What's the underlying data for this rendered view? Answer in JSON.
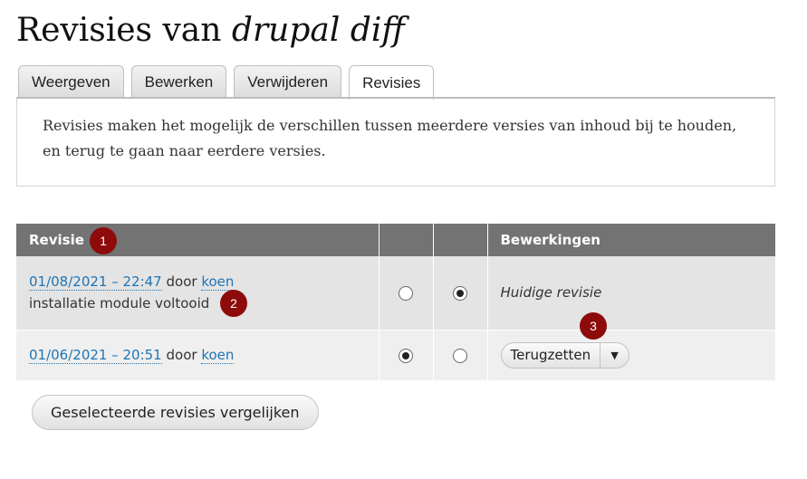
{
  "page": {
    "title_prefix": "Revisies van",
    "title_node": "drupal diff"
  },
  "tabs": [
    {
      "label": "Weergeven",
      "active": false
    },
    {
      "label": "Bewerken",
      "active": false
    },
    {
      "label": "Verwijderen",
      "active": false
    },
    {
      "label": "Revisies",
      "active": true
    }
  ],
  "help": {
    "text": "Revisies maken het mogelijk de verschillen tussen meerdere versies van inhoud bij te houden, en terug te gaan naar eerdere versies."
  },
  "table": {
    "headers": {
      "revision": "Revisie",
      "radio1": "",
      "radio2": "",
      "operations": "Bewerkingen"
    },
    "rows": [
      {
        "date": "01/08/2021 – 22:47",
        "by": "door",
        "author": "koen",
        "message": "installatie module voltooid",
        "radio_left_checked": false,
        "radio_right_checked": true,
        "operation": "Huidige revisie"
      },
      {
        "date": "01/06/2021 – 20:51",
        "by": "door",
        "author": "koen",
        "message": "",
        "radio_left_checked": true,
        "radio_right_checked": false,
        "operation": "Terugzetten"
      }
    ]
  },
  "compare_button": {
    "label": "Geselecteerde revisies vergelijken"
  },
  "markers": [
    "1",
    "2",
    "3"
  ],
  "colors": {
    "header_bg": "#737373",
    "link": "#1f74b5",
    "marker": "#8e0b0b"
  },
  "icons": {
    "dropdown": "caret-down-icon"
  }
}
